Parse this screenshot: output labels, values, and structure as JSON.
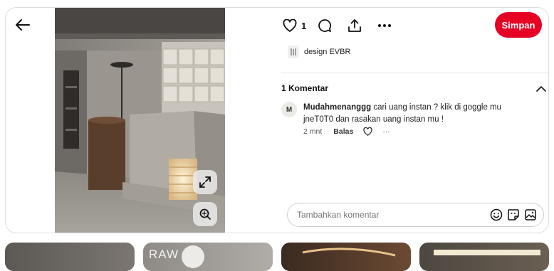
{
  "actions": {
    "like_count": "1",
    "save_label": "Simpan"
  },
  "board": {
    "name": "design EVBR"
  },
  "comments": {
    "title": "1 Komentar",
    "items": [
      {
        "avatar": "M",
        "user": "Mudahmenanggg",
        "text": "cari uang instan ? klik di goggle mu jneT0T0 dan rasakan uang instan mu !",
        "time": "2 mnt",
        "reply": "Balas",
        "more": "···"
      }
    ]
  },
  "comment_box": {
    "placeholder": "Tambahkan komentar"
  },
  "related_pins": [
    {
      "label": ""
    },
    {
      "label": "RAW"
    },
    {
      "label": ""
    },
    {
      "label": ""
    }
  ],
  "icons": [
    "back-arrow-icon",
    "heart-icon",
    "comment-bubble-icon",
    "share-icon",
    "more-icon",
    "expand-icon",
    "visual-search-icon",
    "chevron-up-icon",
    "emoji-icon",
    "sticker-icon",
    "image-icon"
  ]
}
